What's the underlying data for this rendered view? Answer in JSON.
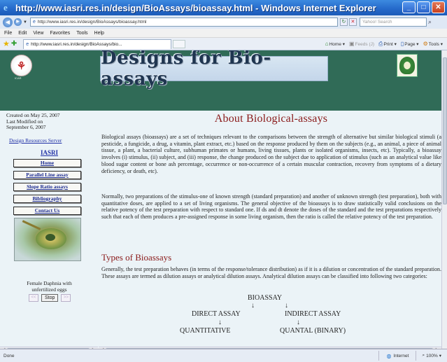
{
  "window": {
    "title": "http://www.iasri.res.in/design/BioAssays/bioassay.html - Windows Internet Explorer",
    "min_icon": "minimize-icon",
    "max_icon": "maximize-icon",
    "close_icon": "close-icon"
  },
  "address_bar": {
    "url": "http://www.iasri.res.in/design/BioAssays/bioassay.html",
    "search_placeholder": "Yahoo! Search"
  },
  "menu": [
    "File",
    "Edit",
    "View",
    "Favorites",
    "Tools",
    "Help"
  ],
  "tab": {
    "label": "http://www.iasri.res.in/design/BioAssays/bio..."
  },
  "command_bar": {
    "home": "Home",
    "feeds": "Feeds (J)",
    "print": "Print",
    "page": "Page",
    "tools": "Tools"
  },
  "banner": {
    "title": "Designs for Bio-assays",
    "left_logo_caption": "ICAR"
  },
  "sidebar": {
    "created": "Created on  May 25, 2007",
    "modified_label": "Last Modified on",
    "modified_date": "September 6, 2007",
    "drs_link": "Design Resources Server",
    "iasri_link": "IASRI",
    "nav": [
      "Home",
      "Parallel Line assay",
      "Slope Ratio assays",
      "Bibliography",
      "Contact Us"
    ],
    "caption_line1": "Female Daphnia with",
    "caption_line2": "unfertilized eggs",
    "stop": "Stop",
    "prev": "<<",
    "next": ">>"
  },
  "main": {
    "heading": "About Biological-assays",
    "p1": "Biological assays (bioassays) are a set of techniques relevant to the comparisons between the strength of alternative but similar biological stimuli (a pesticide, a fungicide, a drug, a vitamin, plant extract, etc.) based on the response produced by them on the subjects (e.g., an animal, a piece of animal tissue, a plant, a bacterial culture, subhuman primates or humans, living tissues, plants or isolated organisms, insects, etc). Typically, a bioassay involves (i) stimulus, (ii) subject, and (iii) response, the change produced on the subject due to application of stimulus (such as an analytical value like blood sugar content or bone ash percentage, occurrence or non-occurrence of a certain muscular contraction, recovery from symptoms of a dietary deficiency, or death, etc).",
    "p2": "Normally, two preparations of the stimulus-one of known strength (standard preparation) and another of unknown strength (test preparation), both with quantitative doses, are applied to a set of living organisms. The general objective of the bioassays is to draw statistically valid conclusions on the relative potency of the test preparation with respect to standard one. If ds and dt denote the doses of the standard and the test preparations respectively such that each of them produces a pre-assigned response in some living organism, then the ratio  is called the relative potency of the test preparation.",
    "types_heading": "Types of Bioassays",
    "p3": "Generally, the test preparation behaves (in terms of the response/tolerance distribution) as if it is a dilution or concentration of the standard preparation. These assays are termed as dilution assays or analytical dilution assays. Analytical dilution assays can be classified into following two categories:",
    "diagram": {
      "root": "BIOASSAY",
      "arrow": "↓",
      "left": "DIRECT ASSAY",
      "right": "INDIRECT ASSAY",
      "left_child": "QUANTITATIVE",
      "right_child": "QUANTAL (BINARY)"
    }
  },
  "status": {
    "text": "Done",
    "zone": "Internet",
    "zoom": "100%"
  }
}
